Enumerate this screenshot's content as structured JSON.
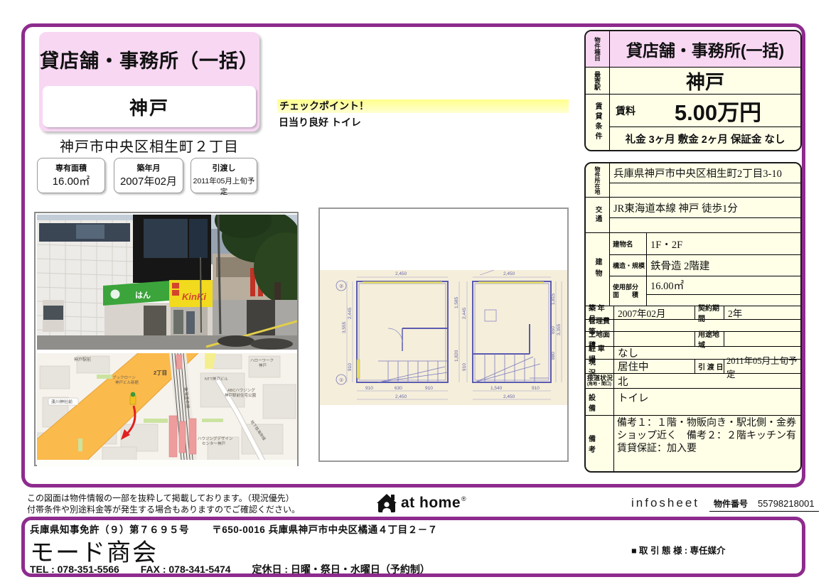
{
  "colors": {
    "frame_purple": "#8E2B8E",
    "pink": "#F8D7F3",
    "cream": "#FFFFE8",
    "highlight_yellow": "#FFFF8C"
  },
  "header": {
    "property_type": "貸店舗・事務所（一括）",
    "station": "神戸",
    "address": "神戸市中央区相生町２丁目",
    "spec_boxes": [
      {
        "label": "専有面積",
        "value": "16.00㎡"
      },
      {
        "label": "築年月",
        "value": "2007年02月"
      },
      {
        "label": "引渡し",
        "value": "2011年05月上旬予定"
      }
    ]
  },
  "checkpoint": {
    "title": "チェックポイント！",
    "body": "日当り良好 トイレ"
  },
  "detail_table": {
    "property_type": {
      "label": "物件種目",
      "value": "貸店舗・事務所(一括)"
    },
    "station": {
      "label": "最寄駅",
      "value": "神戸"
    },
    "rent": {
      "label": "賃貸条件",
      "rent_label": "賃料",
      "rent_value": "5.00万円",
      "fees": "礼金 3ヶ月 敷金 2ヶ月 保証金 なし"
    },
    "location": {
      "label": "物件所在地",
      "value": "兵庫県神戸市中央区相生町2丁目3-10"
    },
    "transport": {
      "label": "交通",
      "value": "JR東海道本線 神戸 徒歩1分"
    },
    "building": {
      "label": "建物",
      "name_label": "建物名",
      "name": "1F・2F",
      "structure_label": "構造・規模",
      "structure": "鉄骨造 2階建",
      "area_label1": "使用部分",
      "area_label2": "面　　積",
      "area": "16.00㎡"
    },
    "built": {
      "label": "築 年 月",
      "value": "2007年02月",
      "label2": "契約期間",
      "value2": "2年"
    },
    "mgmt": {
      "label": "管理費等",
      "value": ""
    },
    "land": {
      "label": "土地面積",
      "value": "",
      "label2": "用途地域",
      "value2": ""
    },
    "parking": {
      "label": "駐 車 場",
      "value": "なし"
    },
    "status": {
      "label": "現　　況",
      "value": "居住中",
      "label2": "引 渡 日",
      "value2": "2011年05月上旬予定"
    },
    "road": {
      "label": "接道状況",
      "label_sub": "(角地・間口)",
      "value": "北"
    },
    "equipment": {
      "label": "設　　備",
      "value": "トイレ"
    },
    "notes": {
      "label": "備　　考",
      "value": "備考１：１階・物販向き・駅北側・金券ショップ近く　備考２：２階キッチン有　賃貸保証：加入要"
    }
  },
  "photo": {
    "sign_text": "KinKi",
    "awning_text": "はん"
  },
  "map": {
    "labels": [
      "神戸駅前",
      "2丁目",
      "東海道本線",
      "NTT神戸ビル",
      "ABCハウジング",
      "神戸駅前住宅公園",
      "ハローワーク",
      "神戸",
      "湊川神社前",
      "ハウジングデザイン",
      "センター神戸",
      "地下鉄海岸線",
      "ブックローン",
      "神戸ビル新館"
    ]
  },
  "floorplan": {
    "plan1": {
      "axis_top": "②",
      "axis_bottom": "①",
      "top": "2,450",
      "left_total": "3,555",
      "left_mid": "2,445",
      "left_low": "910",
      "right_up": "1,585",
      "right_low": "1,820",
      "bottom1": "910",
      "bottom2": "630",
      "bottom3": "910",
      "bottom_total": "2,450"
    },
    "plan2": {
      "top": "2,450",
      "left_mid": "2,445",
      "left_low": "910",
      "right_up": "1,815",
      "right_mid": "650",
      "right_low": "880",
      "right_total": "3,355",
      "bottom1": "1,540",
      "bottom2": "910",
      "bottom_total": "2,450"
    }
  },
  "footer": {
    "disclaimer1": "この図面は物件情報の一部を抜粋して掲載しております。（現況優先）",
    "disclaimer2": "付帯条件や別途料金等が発生する場合もありますのでご確認ください。",
    "logo_text": "at home",
    "logo_reg": "®",
    "infosheet": "infosheet",
    "property_no_label": "物件番号",
    "property_no": "55798218001"
  },
  "company": {
    "license_no": "兵庫県知事免許（９）第７６９５号",
    "office_address": "〒650-0016 兵庫県神戸市中央区橘通４丁目２－７",
    "name": "モード商会",
    "tel": "TEL : 078-351-5566",
    "fax": "FAX : 078-341-5474",
    "closed": "定休日 : 日曜・祭日・水曜日（予約制）",
    "transaction": "■ 取 引 態 様 : 専任媒介"
  }
}
